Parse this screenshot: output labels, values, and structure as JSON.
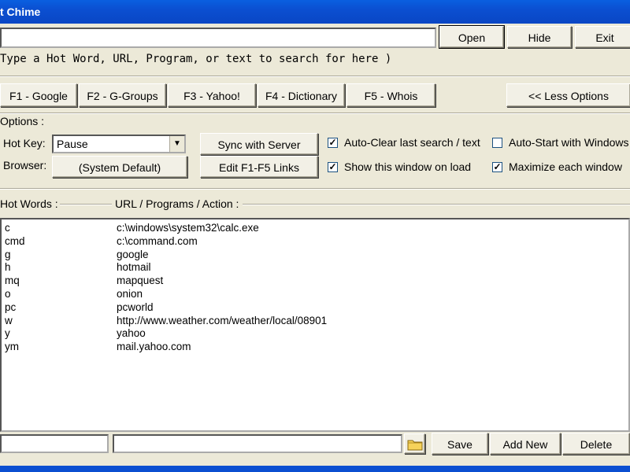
{
  "window": {
    "title": "t Chime"
  },
  "command": {
    "input_value": "",
    "open_label": "Open",
    "hide_label": "Hide",
    "exit_label": "Exit"
  },
  "hint_text": "Type a Hot Word, URL, Program, or text to search for here )",
  "fkeys": [
    {
      "key": "F1",
      "label": " - Google"
    },
    {
      "key": "F2",
      "label": " - G-Groups"
    },
    {
      "key": "F3",
      "label": " - Yahoo!"
    },
    {
      "key": "F4",
      "label": " - Dictionary"
    },
    {
      "key": "F5",
      "label": " - Whois"
    }
  ],
  "less_options_label": "<< Less Options",
  "options": {
    "title": "Options :",
    "hotkey_label": "Hot Key:",
    "hotkey_value": "Pause",
    "browser_label": "Browser:",
    "browser_value": "(System Default)",
    "sync_label": "Sync with Server",
    "edit_links_label": "Edit F1-F5 Links",
    "checkboxes": [
      {
        "label": "Auto-Clear last search / text",
        "checked": true
      },
      {
        "label": "Auto-Start with Windows",
        "checked": false
      },
      {
        "label": "Show this window on load",
        "checked": true
      },
      {
        "label": "Maximize each window",
        "checked": true
      }
    ]
  },
  "list": {
    "hotwords_header": "Hot Words :",
    "actions_header": "URL / Programs / Action :",
    "rows": [
      {
        "hot": "c",
        "action": "c:\\windows\\system32\\calc.exe"
      },
      {
        "hot": "cmd",
        "action": "c:\\command.com"
      },
      {
        "hot": "g",
        "action": "google"
      },
      {
        "hot": "h",
        "action": "hotmail"
      },
      {
        "hot": "mq",
        "action": "mapquest"
      },
      {
        "hot": "o",
        "action": "onion"
      },
      {
        "hot": "pc",
        "action": "pcworld"
      },
      {
        "hot": "w",
        "action": "http://www.weather.com/weather/local/08901"
      },
      {
        "hot": "y",
        "action": "yahoo"
      },
      {
        "hot": "ym",
        "action": "mail.yahoo.com"
      }
    ]
  },
  "footer": {
    "hotword_input": "",
    "action_input": "",
    "save_label": "Save",
    "add_new_label": "Add New",
    "delete_label": "Delete"
  }
}
